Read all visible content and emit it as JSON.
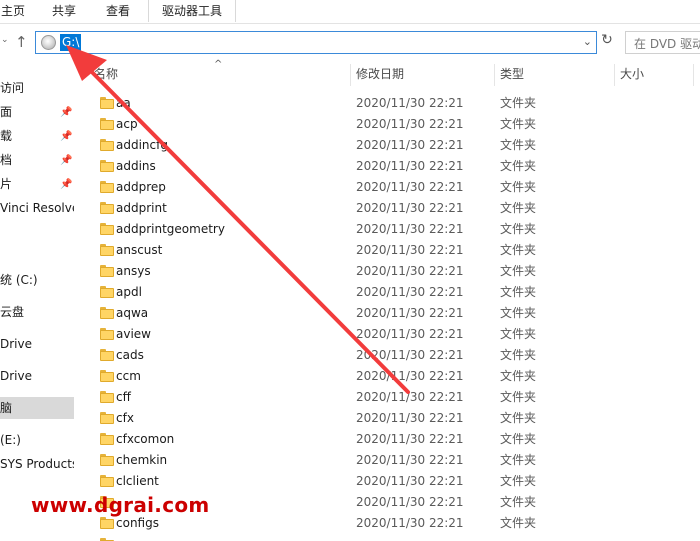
{
  "ribbon": {
    "tabs": [
      "主页",
      "共享",
      "查看",
      "驱动器工具"
    ]
  },
  "address": {
    "path": "G:\\",
    "search_placeholder": "在 DVD 驱动"
  },
  "sidebar": {
    "items": [
      {
        "label": "访问",
        "pinned": false
      },
      {
        "label": "面",
        "pinned": true
      },
      {
        "label": "载",
        "pinned": true
      },
      {
        "label": "档",
        "pinned": true
      },
      {
        "label": "片",
        "pinned": true
      },
      {
        "label": "Vinci Resolve",
        "pinned": false
      },
      {
        "label": "统 (C:)",
        "pinned": false
      },
      {
        "label": "云盘",
        "pinned": false
      },
      {
        "label": "Drive",
        "pinned": false
      },
      {
        "label": "Drive",
        "pinned": false
      },
      {
        "label": "脑",
        "pinned": false
      },
      {
        "label": " (E:)",
        "pinned": false
      },
      {
        "label": "SYS Products",
        "pinned": false
      }
    ]
  },
  "columns": {
    "name": "名称",
    "date": "修改日期",
    "type": "类型",
    "size": "大小"
  },
  "files": [
    {
      "name": "aa",
      "date": "2020/11/30 22:21",
      "type": "文件夹"
    },
    {
      "name": "acp",
      "date": "2020/11/30 22:21",
      "type": "文件夹"
    },
    {
      "name": "addincfg",
      "date": "2020/11/30 22:21",
      "type": "文件夹"
    },
    {
      "name": "addins",
      "date": "2020/11/30 22:21",
      "type": "文件夹"
    },
    {
      "name": "addprep",
      "date": "2020/11/30 22:21",
      "type": "文件夹"
    },
    {
      "name": "addprint",
      "date": "2020/11/30 22:21",
      "type": "文件夹"
    },
    {
      "name": "addprintgeometry",
      "date": "2020/11/30 22:21",
      "type": "文件夹"
    },
    {
      "name": "anscust",
      "date": "2020/11/30 22:21",
      "type": "文件夹"
    },
    {
      "name": "ansys",
      "date": "2020/11/30 22:21",
      "type": "文件夹"
    },
    {
      "name": "apdl",
      "date": "2020/11/30 22:21",
      "type": "文件夹"
    },
    {
      "name": "aqwa",
      "date": "2020/11/30 22:21",
      "type": "文件夹"
    },
    {
      "name": "aview",
      "date": "2020/11/30 22:21",
      "type": "文件夹"
    },
    {
      "name": "cads",
      "date": "2020/11/30 22:21",
      "type": "文件夹"
    },
    {
      "name": "ccm",
      "date": "2020/11/30 22:21",
      "type": "文件夹"
    },
    {
      "name": "cff",
      "date": "2020/11/30 22:21",
      "type": "文件夹"
    },
    {
      "name": "cfx",
      "date": "2020/11/30 22:21",
      "type": "文件夹"
    },
    {
      "name": "cfxcomon",
      "date": "2020/11/30 22:21",
      "type": "文件夹"
    },
    {
      "name": "chemkin",
      "date": "2020/11/30 22:21",
      "type": "文件夹"
    },
    {
      "name": "clclient",
      "date": "2020/11/30 22:21",
      "type": "文件夹"
    },
    {
      "name": "",
      "date": "2020/11/30 22:21",
      "type": "文件夹"
    },
    {
      "name": "configs",
      "date": "2020/11/30 22:21",
      "type": "文件夹"
    },
    {
      "name": "",
      "date": "",
      "type": ""
    }
  ],
  "watermark": "www.dgrai.com"
}
